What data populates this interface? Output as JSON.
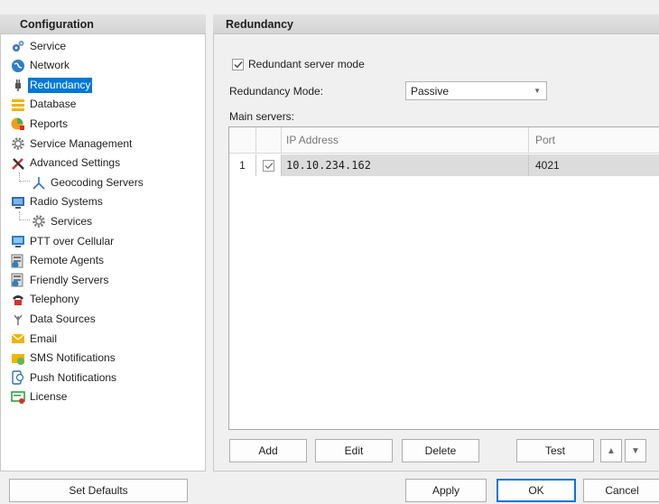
{
  "config_panel": {
    "title": "Configuration",
    "items": [
      {
        "label": "Service",
        "icon": "gears-icon",
        "level": 0,
        "selected": false
      },
      {
        "label": "Network",
        "icon": "globe-icon",
        "level": 0,
        "selected": false
      },
      {
        "label": "Redundancy",
        "icon": "plug-icon",
        "level": 0,
        "selected": true
      },
      {
        "label": "Database",
        "icon": "database-icon",
        "level": 0,
        "selected": false
      },
      {
        "label": "Reports",
        "icon": "reports-icon",
        "level": 0,
        "selected": false
      },
      {
        "label": "Service Management",
        "icon": "gear-icon",
        "level": 0,
        "selected": false
      },
      {
        "label": "Advanced Settings",
        "icon": "tools-icon",
        "level": 0,
        "selected": false
      },
      {
        "label": "Geocoding Servers",
        "icon": "geocoding-icon",
        "level": 1,
        "selected": false
      },
      {
        "label": "Radio Systems",
        "icon": "radio-systems-icon",
        "level": 0,
        "selected": false
      },
      {
        "label": "Services",
        "icon": "gear-icon",
        "level": 1,
        "selected": false
      },
      {
        "label": "PTT over Cellular",
        "icon": "ptt-icon",
        "level": 0,
        "selected": false
      },
      {
        "label": "Remote Agents",
        "icon": "server-icon",
        "level": 0,
        "selected": false
      },
      {
        "label": "Friendly Servers",
        "icon": "server-icon",
        "level": 0,
        "selected": false
      },
      {
        "label": "Telephony",
        "icon": "telephone-icon",
        "level": 0,
        "selected": false
      },
      {
        "label": "Data Sources",
        "icon": "data-source-icon",
        "level": 0,
        "selected": false
      },
      {
        "label": "Email",
        "icon": "envelope-icon",
        "level": 0,
        "selected": false
      },
      {
        "label": "SMS Notifications",
        "icon": "sms-icon",
        "level": 0,
        "selected": false
      },
      {
        "label": "Push Notifications",
        "icon": "push-icon",
        "level": 0,
        "selected": false
      },
      {
        "label": "License",
        "icon": "license-icon",
        "level": 0,
        "selected": false
      }
    ]
  },
  "main_panel": {
    "title": "Redundancy",
    "redundant_mode": {
      "label": "Redundant server mode",
      "checked": true
    },
    "redundancy_mode_label": "Redundancy Mode:",
    "redundancy_mode_value": "Passive",
    "main_servers_label": "Main servers:",
    "grid": {
      "columns": [
        "",
        "",
        "IP Address",
        "Port"
      ],
      "rows": [
        {
          "index": "1",
          "checked": true,
          "ip": "10.10.234.162",
          "port": "4021"
        }
      ]
    },
    "buttons": {
      "add": "Add",
      "edit": "Edit",
      "delete": "Delete",
      "test": "Test",
      "up": "▲",
      "down": "▼"
    }
  },
  "footer": {
    "set_defaults": "Set Defaults",
    "apply": "Apply",
    "ok": "OK",
    "cancel": "Cancel"
  },
  "colors": {
    "selection": "#0078d7",
    "header_bg": "#d9d9d9"
  }
}
